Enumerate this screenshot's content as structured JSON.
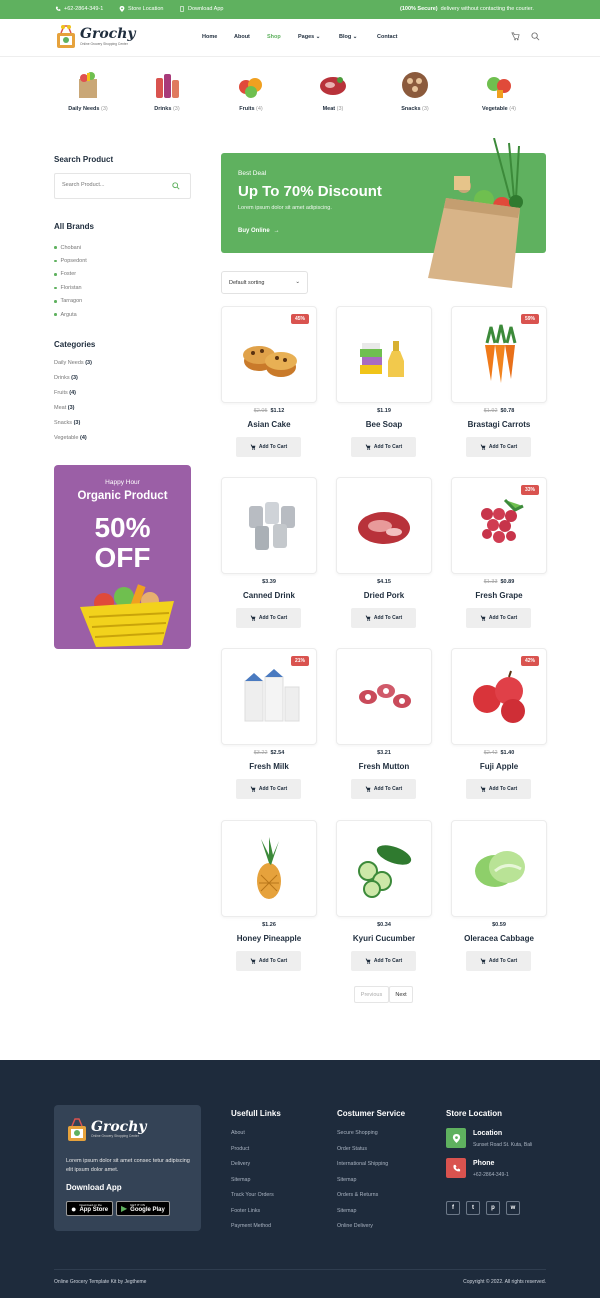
{
  "topbar": {
    "phone": "+62-2864-349-1",
    "store_location": "Store Location",
    "download_app": "Download App",
    "secure_bold": "(100% Secure)",
    "secure_text": " delivery without contacting the courier."
  },
  "brand": {
    "name": "Grochy",
    "tagline": "Online Grocery Shopping Center"
  },
  "nav": {
    "items": [
      "Home",
      "About",
      "Shop",
      "Pages",
      "Blog",
      "Contact"
    ],
    "active": "Shop"
  },
  "categories_bar": [
    {
      "label": "Daily Needs",
      "count": "(3)"
    },
    {
      "label": "Drinks",
      "count": "(3)"
    },
    {
      "label": "Fruits",
      "count": "(4)"
    },
    {
      "label": "Meat",
      "count": "(3)"
    },
    {
      "label": "Snacks",
      "count": "(3)"
    },
    {
      "label": "Vegetable",
      "count": "(4)"
    }
  ],
  "sidebar": {
    "search_title": "Search Product",
    "search_placeholder": "Search Product...",
    "brands_title": "All Brands",
    "brands": [
      "Chobani",
      "Popsedont",
      "Foster",
      "Floristan",
      "Tarragon",
      "Arguta"
    ],
    "categories_title": "Categories",
    "categories": [
      {
        "label": "Daily Needs",
        "count": "(3)"
      },
      {
        "label": "Drinks",
        "count": "(3)"
      },
      {
        "label": "Fruits",
        "count": "(4)"
      },
      {
        "label": "Meat",
        "count": "(3)"
      },
      {
        "label": "Snacks",
        "count": "(3)"
      },
      {
        "label": "Vegetable",
        "count": "(4)"
      }
    ],
    "promo": {
      "subtitle": "Happy Hour",
      "title": "Organic Product",
      "line1": "50%",
      "line2": "OFF"
    }
  },
  "banner": {
    "eyebrow": "Best Deal",
    "title": "Up To 70% Discount",
    "text": "Lorem ipsum dolor sit amet adipiscing.",
    "cta": "Buy Online"
  },
  "sort": {
    "selected": "Default sorting"
  },
  "products": [
    {
      "name": "Asian Cake",
      "old_price": "$2.05",
      "price": "$1.12",
      "discount": "45%",
      "icon": "muffin-image"
    },
    {
      "name": "Bee Soap",
      "old_price": "",
      "price": "$1.19",
      "discount": "",
      "icon": "soap-image"
    },
    {
      "name": "Brastagi Carrots",
      "old_price": "$1.92",
      "price": "$0.78",
      "discount": "59%",
      "icon": "carrot-image"
    },
    {
      "name": "Canned Drink",
      "old_price": "",
      "price": "$3.39",
      "discount": "",
      "icon": "can-image"
    },
    {
      "name": "Dried Pork",
      "old_price": "",
      "price": "$4.15",
      "discount": "",
      "icon": "pork-image"
    },
    {
      "name": "Fresh Grape",
      "old_price": "$1.33",
      "price": "$0.89",
      "discount": "33%",
      "icon": "grape-image"
    },
    {
      "name": "Fresh Milk",
      "old_price": "$3.22",
      "price": "$2.54",
      "discount": "21%",
      "icon": "milk-image"
    },
    {
      "name": "Fresh Mutton",
      "old_price": "",
      "price": "$3.21",
      "discount": "",
      "icon": "mutton-image"
    },
    {
      "name": "Fuji Apple",
      "old_price": "$2.42",
      "price": "$1.40",
      "discount": "42%",
      "icon": "apple-image"
    },
    {
      "name": "Honey Pineapple",
      "old_price": "",
      "price": "$1.26",
      "discount": "",
      "icon": "pineapple-image"
    },
    {
      "name": "Kyuri Cucumber",
      "old_price": "",
      "price": "$0.34",
      "discount": "",
      "icon": "cucumber-image"
    },
    {
      "name": "Oleracea Cabbage",
      "old_price": "",
      "price": "$0.59",
      "discount": "",
      "icon": "cabbage-image"
    }
  ],
  "add_to_cart": "Add To Cart",
  "pagination": {
    "previous": "Previous",
    "next": "Next"
  },
  "footer": {
    "about_text": "Lorem ipsum dolor sit amet consec tetur adipiscing elit ipsum dolor amet.",
    "download_title": "Download App",
    "app_store_small": "Download on the",
    "app_store": "App Store",
    "google_small": "GET IT ON",
    "google": "Google Play",
    "col1_title": "Usefull Links",
    "col1": [
      "About",
      "Product",
      "Delivery",
      "Sitemap",
      "Track Your Orders",
      "Footer Links",
      "Payment Method"
    ],
    "col2_title": "Costumer Service",
    "col2": [
      "Secure Shopping",
      "Order Status",
      "International Shipping",
      "Sitemap",
      "Orders & Returns",
      "Sitemap",
      "Online Delivery"
    ],
    "col3_title": "Store Location",
    "location_label": "Location",
    "location_value": "Sunset Road St. Kuta, Bali",
    "phone_label": "Phone",
    "phone_value": "+62-2864-349-1",
    "socials": [
      "f",
      "t",
      "p",
      "w"
    ],
    "bottom_left": "Online Grocery Template Kit by Jegtheme",
    "bottom_right": "Copyright © 2022. All rights reserved."
  },
  "colors": {
    "accent": "#5fb15f",
    "discount": "#d9534f",
    "promo": "#9b5fa6",
    "footer": "#1e2b3c"
  }
}
